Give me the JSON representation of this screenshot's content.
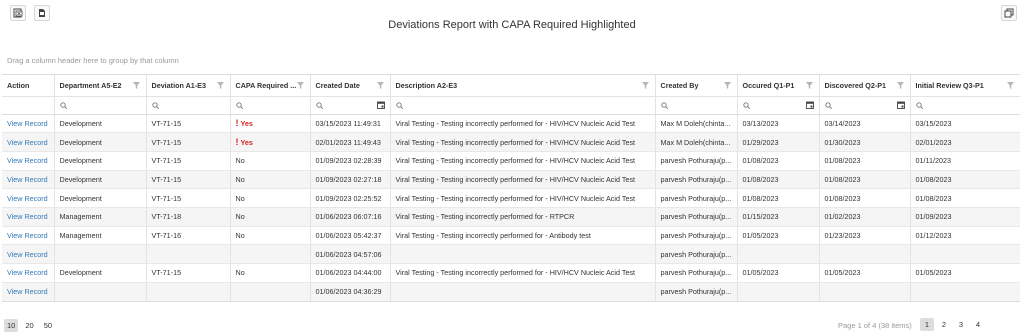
{
  "toolbar": {
    "export_excel_icon": "excel-export-icon",
    "export_pdf_icon": "pdf-export-icon",
    "restore_icon": "restore-window-icon"
  },
  "title": "Deviations Report with CAPA Required Highlighted",
  "group_panel_hint": "Drag a column header here to group by that column",
  "columns": [
    "Action",
    "Department A5-E2",
    "Deviation A1-E3",
    "CAPA Required ...",
    "Created Date",
    "Description A2-E3",
    "Created By",
    "Occured Q1-P1",
    "Discovered Q2-P1",
    "Initial Review Q3-P1"
  ],
  "rows": [
    {
      "action": "View Record",
      "department": "Development",
      "deviation": "VT-71-15",
      "capa": "Yes",
      "created_date": "03/15/2023 11:49:31",
      "description": "Viral Testing - Testing incorrectly performed for - HIV/HCV Nucleic Acid Test",
      "created_by": "Max M Doleh(chinta...",
      "occured": "03/13/2023",
      "discovered": "03/14/2023",
      "initial_review": "03/15/2023"
    },
    {
      "action": "View Record",
      "department": "Development",
      "deviation": "VT-71-15",
      "capa": "Yes",
      "created_date": "02/01/2023 11:49:43",
      "description": "Viral Testing - Testing incorrectly performed for - HIV/HCV Nucleic Acid Test",
      "created_by": "Max M Doleh(chinta...",
      "occured": "01/29/2023",
      "discovered": "01/30/2023",
      "initial_review": "02/01/2023"
    },
    {
      "action": "View Record",
      "department": "Development",
      "deviation": "VT-71-15",
      "capa": "No",
      "created_date": "01/09/2023 02:28:39",
      "description": "Viral Testing - Testing incorrectly performed for - HIV/HCV Nucleic Acid Test",
      "created_by": "parvesh Pothuraju(p...",
      "occured": "01/08/2023",
      "discovered": "01/08/2023",
      "initial_review": "01/11/2023"
    },
    {
      "action": "View Record",
      "department": "Development",
      "deviation": "VT-71-15",
      "capa": "No",
      "created_date": "01/09/2023 02:27:18",
      "description": "Viral Testing - Testing incorrectly performed for - HIV/HCV Nucleic Acid Test",
      "created_by": "parvesh Pothuraju(p...",
      "occured": "01/08/2023",
      "discovered": "01/08/2023",
      "initial_review": "01/08/2023"
    },
    {
      "action": "View Record",
      "department": "Development",
      "deviation": "VT-71-15",
      "capa": "No",
      "created_date": "01/09/2023 02:25:52",
      "description": "Viral Testing - Testing incorrectly performed for - HIV/HCV Nucleic Acid Test",
      "created_by": "parvesh Pothuraju(p...",
      "occured": "01/08/2023",
      "discovered": "01/08/2023",
      "initial_review": "01/08/2023"
    },
    {
      "action": "View Record",
      "department": "Management",
      "deviation": "VT-71-18",
      "capa": "No",
      "created_date": "01/06/2023 06:07:16",
      "description": "Viral Testing - Testing incorrectly performed for - RTPCR",
      "created_by": "parvesh Pothuraju(p...",
      "occured": "01/15/2023",
      "discovered": "01/02/2023",
      "initial_review": "01/09/2023"
    },
    {
      "action": "View Record",
      "department": "Management",
      "deviation": "VT-71-16",
      "capa": "No",
      "created_date": "01/06/2023 05:42:37",
      "description": "Viral Testing - Testing incorrectly performed for - Antibody test",
      "created_by": "parvesh Pothuraju(p...",
      "occured": "01/05/2023",
      "discovered": "01/23/2023",
      "initial_review": "01/12/2023"
    },
    {
      "action": "View Record",
      "department": "",
      "deviation": "",
      "capa": "",
      "created_date": "01/06/2023 04:57:06",
      "description": "",
      "created_by": "parvesh Pothuraju(p...",
      "occured": "",
      "discovered": "",
      "initial_review": ""
    },
    {
      "action": "View Record",
      "department": "Development",
      "deviation": "VT-71-15",
      "capa": "No",
      "created_date": "01/06/2023 04:44:00",
      "description": "Viral Testing - Testing incorrectly performed for - HIV/HCV Nucleic Acid Test",
      "created_by": "parvesh Pothuraju(p...",
      "occured": "01/05/2023",
      "discovered": "01/05/2023",
      "initial_review": "01/05/2023"
    },
    {
      "action": "View Record",
      "department": "",
      "deviation": "",
      "capa": "",
      "created_date": "01/06/2023 04:36:29",
      "description": "",
      "created_by": "parvesh Pothuraju(p...",
      "occured": "",
      "discovered": "",
      "initial_review": ""
    }
  ],
  "pager": {
    "page_sizes": [
      "10",
      "20",
      "50"
    ],
    "active_page_size": "10",
    "info": "Page 1 of 4 (38 items)",
    "pages": [
      "1",
      "2",
      "3",
      "4"
    ],
    "active_page": "1"
  },
  "colors": {
    "link": "#337ab7",
    "capa_yes": "#d9231d",
    "alt_row": "#f5f5f5"
  }
}
